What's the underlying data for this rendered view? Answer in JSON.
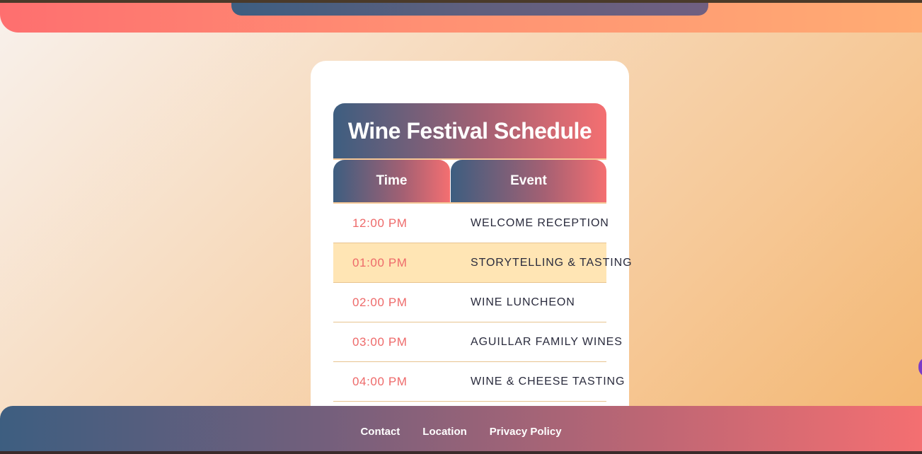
{
  "schedule": {
    "title": "Wine Festival Schedule",
    "columns": {
      "time": "Time",
      "event": "Event"
    },
    "rows": [
      {
        "time": "12:00 PM",
        "event": "WELCOME RECEPTION"
      },
      {
        "time": "01:00 PM",
        "event": "STORYTELLING & TASTING",
        "highlighted": true
      },
      {
        "time": "02:00 PM",
        "event": "WINE LUNCHEON"
      },
      {
        "time": "03:00 PM",
        "event": "AGUILLAR FAMILY WINES"
      },
      {
        "time": "04:00 PM",
        "event": "WINE & CHEESE TASTING"
      }
    ]
  },
  "footer": {
    "links": [
      "Contact",
      "Location",
      "Privacy Policy"
    ]
  },
  "colors": {
    "accent_coral": "#f46f71",
    "accent_navy": "#3d5e80",
    "highlight_row": "#ffe5b4",
    "time_text": "#ee6a6a"
  }
}
